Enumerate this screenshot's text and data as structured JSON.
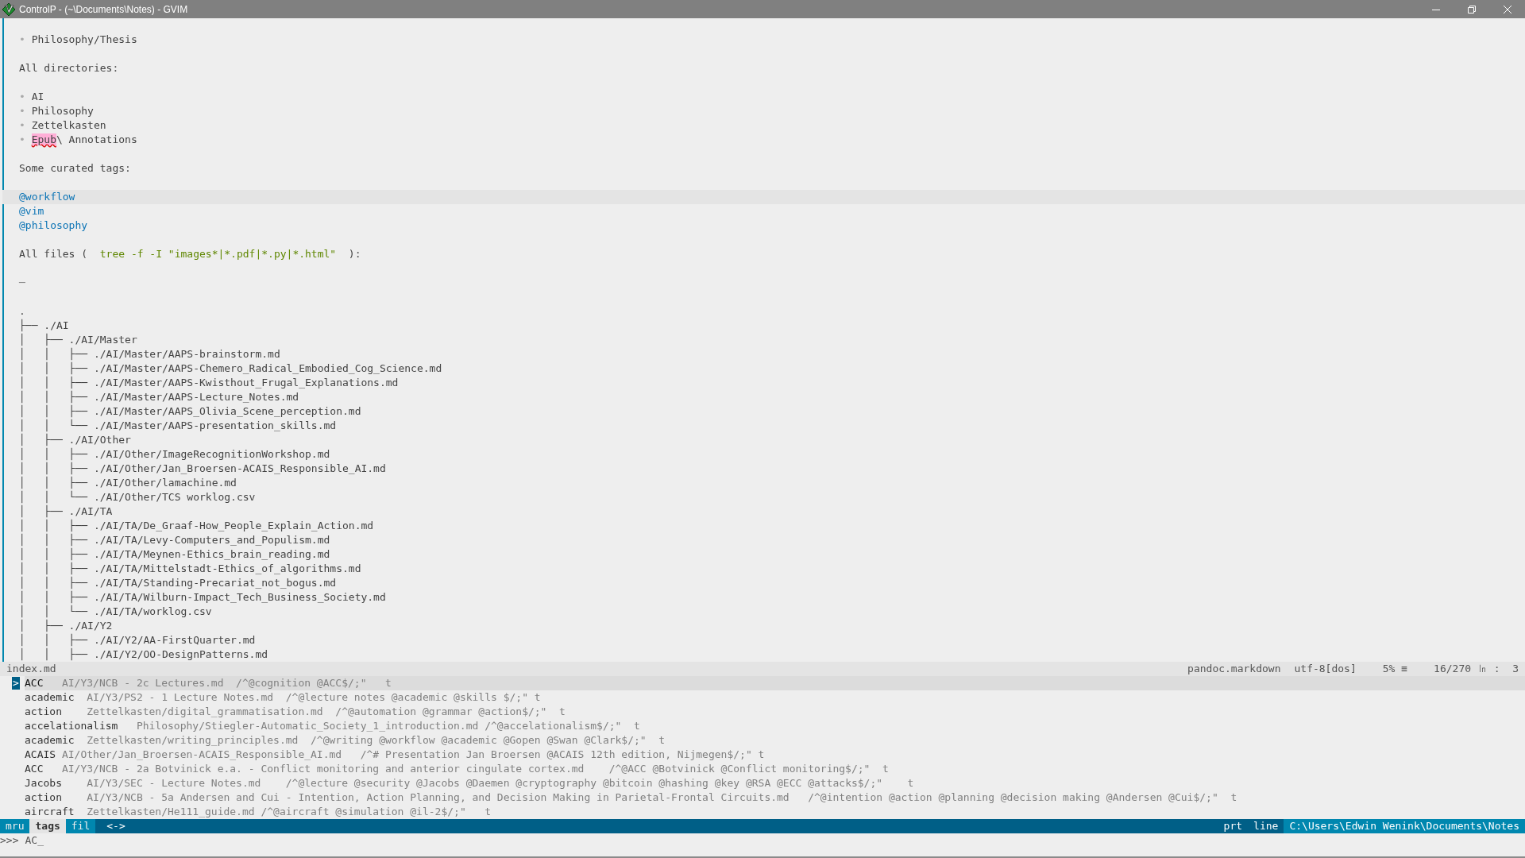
{
  "window": {
    "title": "ControlP - (~\\Documents\\Notes) - GVIM"
  },
  "editor": {
    "lines": [
      {
        "kind": "blank",
        "current": false
      },
      {
        "kind": "text",
        "current": false,
        "segments": [
          {
            "kind": "bullet",
            "text": "• "
          },
          {
            "kind": "plain",
            "text": "Philosophy/Thesis"
          }
        ]
      },
      {
        "kind": "blank",
        "current": false
      },
      {
        "kind": "text",
        "current": false,
        "segments": [
          {
            "kind": "plain",
            "text": "All directories:"
          }
        ]
      },
      {
        "kind": "blank",
        "current": false
      },
      {
        "kind": "text",
        "current": false,
        "segments": [
          {
            "kind": "bullet",
            "text": "• "
          },
          {
            "kind": "plain",
            "text": "AI"
          }
        ]
      },
      {
        "kind": "text",
        "current": false,
        "segments": [
          {
            "kind": "bullet",
            "text": "• "
          },
          {
            "kind": "plain",
            "text": "Philosophy"
          }
        ]
      },
      {
        "kind": "text",
        "current": false,
        "segments": [
          {
            "kind": "bullet",
            "text": "• "
          },
          {
            "kind": "plain",
            "text": "Zettelkasten"
          }
        ]
      },
      {
        "kind": "text",
        "current": false,
        "segments": [
          {
            "kind": "bullet",
            "text": "• "
          },
          {
            "kind": "spell",
            "text": "Epub"
          },
          {
            "kind": "plain",
            "text": "\\ Annotations"
          }
        ]
      },
      {
        "kind": "blank",
        "current": false
      },
      {
        "kind": "text",
        "current": false,
        "segments": [
          {
            "kind": "plain",
            "text": "Some curated tags:"
          }
        ]
      },
      {
        "kind": "blank",
        "current": false
      },
      {
        "kind": "text",
        "current": true,
        "segments": [
          {
            "kind": "tag",
            "text": "@workflow"
          }
        ]
      },
      {
        "kind": "text",
        "current": false,
        "segments": [
          {
            "kind": "tag",
            "text": "@vim"
          }
        ]
      },
      {
        "kind": "text",
        "current": false,
        "segments": [
          {
            "kind": "tag",
            "text": "@philosophy"
          }
        ]
      },
      {
        "kind": "blank",
        "current": false
      },
      {
        "kind": "text",
        "current": false,
        "segments": [
          {
            "kind": "plain",
            "text": "All files (  "
          },
          {
            "kind": "code",
            "text": "tree -f -I \"images*|*.pdf|*.py|*.html\""
          },
          {
            "kind": "plain",
            "text": "  ):"
          }
        ]
      },
      {
        "kind": "blank",
        "current": false
      },
      {
        "kind": "text",
        "current": false,
        "segments": [
          {
            "kind": "dim",
            "text": "─"
          }
        ]
      },
      {
        "kind": "blank",
        "current": false
      },
      {
        "kind": "text",
        "current": false,
        "segments": [
          {
            "kind": "plain",
            "text": "."
          }
        ]
      },
      {
        "kind": "text",
        "current": false,
        "segments": [
          {
            "kind": "plain",
            "text": "├── ./AI"
          }
        ]
      },
      {
        "kind": "text",
        "current": false,
        "segments": [
          {
            "kind": "plain",
            "text": "│   ├── ./AI/Master"
          }
        ]
      },
      {
        "kind": "text",
        "current": false,
        "segments": [
          {
            "kind": "plain",
            "text": "│   │   ├── ./AI/Master/AAPS-brainstorm.md"
          }
        ]
      },
      {
        "kind": "text",
        "current": false,
        "segments": [
          {
            "kind": "plain",
            "text": "│   │   ├── ./AI/Master/AAPS-Chemero_Radical_Embodied_Cog_Science.md"
          }
        ]
      },
      {
        "kind": "text",
        "current": false,
        "segments": [
          {
            "kind": "plain",
            "text": "│   │   ├── ./AI/Master/AAPS-Kwisthout_Frugal_Explanations.md"
          }
        ]
      },
      {
        "kind": "text",
        "current": false,
        "segments": [
          {
            "kind": "plain",
            "text": "│   │   ├── ./AI/Master/AAPS-Lecture_Notes.md"
          }
        ]
      },
      {
        "kind": "text",
        "current": false,
        "segments": [
          {
            "kind": "plain",
            "text": "│   │   ├── ./AI/Master/AAPS_Olivia_Scene_perception.md"
          }
        ]
      },
      {
        "kind": "text",
        "current": false,
        "segments": [
          {
            "kind": "plain",
            "text": "│   │   └── ./AI/Master/AAPS-presentation_skills.md"
          }
        ]
      },
      {
        "kind": "text",
        "current": false,
        "segments": [
          {
            "kind": "plain",
            "text": "│   ├── ./AI/Other"
          }
        ]
      },
      {
        "kind": "text",
        "current": false,
        "segments": [
          {
            "kind": "plain",
            "text": "│   │   ├── ./AI/Other/ImageRecognitionWorkshop.md"
          }
        ]
      },
      {
        "kind": "text",
        "current": false,
        "segments": [
          {
            "kind": "plain",
            "text": "│   │   ├── ./AI/Other/Jan_Broersen-ACAIS_Responsible_AI.md"
          }
        ]
      },
      {
        "kind": "text",
        "current": false,
        "segments": [
          {
            "kind": "plain",
            "text": "│   │   ├── ./AI/Other/lamachine.md"
          }
        ]
      },
      {
        "kind": "text",
        "current": false,
        "segments": [
          {
            "kind": "plain",
            "text": "│   │   └── ./AI/Other/TCS worklog.csv"
          }
        ]
      },
      {
        "kind": "text",
        "current": false,
        "segments": [
          {
            "kind": "plain",
            "text": "│   ├── ./AI/TA"
          }
        ]
      },
      {
        "kind": "text",
        "current": false,
        "segments": [
          {
            "kind": "plain",
            "text": "│   │   ├── ./AI/TA/De_Graaf-How_People_Explain_Action.md"
          }
        ]
      },
      {
        "kind": "text",
        "current": false,
        "segments": [
          {
            "kind": "plain",
            "text": "│   │   ├── ./AI/TA/Levy-Computers_and_Populism.md"
          }
        ]
      },
      {
        "kind": "text",
        "current": false,
        "segments": [
          {
            "kind": "plain",
            "text": "│   │   ├── ./AI/TA/Meynen-Ethics_brain_reading.md"
          }
        ]
      },
      {
        "kind": "text",
        "current": false,
        "segments": [
          {
            "kind": "plain",
            "text": "│   │   ├── ./AI/TA/Mittelstadt-Ethics_of_algorithms.md"
          }
        ]
      },
      {
        "kind": "text",
        "current": false,
        "segments": [
          {
            "kind": "plain",
            "text": "│   │   ├── ./AI/TA/Standing-Precariat_not_bogus.md"
          }
        ]
      },
      {
        "kind": "text",
        "current": false,
        "segments": [
          {
            "kind": "plain",
            "text": "│   │   ├── ./AI/TA/Wilburn-Impact_Tech_Business_Society.md"
          }
        ]
      },
      {
        "kind": "text",
        "current": false,
        "segments": [
          {
            "kind": "plain",
            "text": "│   │   └── ./AI/TA/worklog.csv"
          }
        ]
      },
      {
        "kind": "text",
        "current": false,
        "segments": [
          {
            "kind": "plain",
            "text": "│   ├── ./AI/Y2"
          }
        ]
      },
      {
        "kind": "text",
        "current": false,
        "segments": [
          {
            "kind": "plain",
            "text": "│   │   ├── ./AI/Y2/AA-FirstQuarter.md"
          }
        ]
      },
      {
        "kind": "text",
        "current": false,
        "segments": [
          {
            "kind": "plain",
            "text": "│   │   ├── ./AI/Y2/OO-DesignPatterns.md"
          }
        ]
      }
    ]
  },
  "status_line": {
    "file": "index.md",
    "filetype": "pandoc.markdown",
    "encoding": "utf-8[dos]",
    "percent": "5% ≡",
    "position": "16/270 ㏑ :  3"
  },
  "matches": {
    "marker": ">",
    "rows": [
      {
        "selected": true,
        "tag": "ACC",
        "rest": "   AI/Y3/NCB - 2c Lectures.md  /^@cognition @ACC$/;\"   t"
      },
      {
        "selected": false,
        "tag": "academic",
        "rest": "  AI/Y3/PS2 - 1 Lecture Notes.md  /^@lecture notes @academic @skills $/;\" t"
      },
      {
        "selected": false,
        "tag": "action",
        "rest": "    Zettelkasten/digital_grammatisation.md  /^@automation @grammar @action$/;\"  t"
      },
      {
        "selected": false,
        "tag": "accelationalism",
        "rest": "   Philosophy/Stiegler-Automatic_Society_1_introduction.md /^@accelationalism$/;\"  t"
      },
      {
        "selected": false,
        "tag": "academic",
        "rest": "  Zettelkasten/writing_principles.md  /^@writing @workflow @academic @Gopen @Swan @Clark$/;\"  t"
      },
      {
        "selected": false,
        "tag": "ACAIS",
        "rest": " AI/Other/Jan_Broersen-ACAIS_Responsible_AI.md   /^# Presentation Jan Broersen @ACAIS 12th edition, Nijmegen$/;\" t"
      },
      {
        "selected": false,
        "tag": "ACC",
        "rest": "   AI/Y3/NCB - 2a Botvinick e.a. - Conflict monitoring and anterior cingulate cortex.md    /^@ACC @Botvinick @Conflict monitoring$/;\"  t"
      },
      {
        "selected": false,
        "tag": "Jacobs",
        "rest": "    AI/Y3/SEC - Lecture Notes.md    /^@lecture @security @Jacobs @Daemen @cryptography @bitcoin @hashing @key @RSA @ECC @attacks$/;\"    t"
      },
      {
        "selected": false,
        "tag": "action",
        "rest": "    AI/Y3/NCB - 5a Andersen and Cui - Intention, Action Planning, and Decision Making in Parietal-Frontal Circuits.md   /^@intention @action @planning @decision making @Andersen @Cui$/;\"  t"
      },
      {
        "selected": false,
        "tag": "aircraft",
        "rest": "  Zettelkasten/He111_guide.md /^@aircraft @simulation @il-2$/;\"   t"
      }
    ]
  },
  "ctrlp_bar": {
    "modes": [
      {
        "label": "mru",
        "selected": false
      },
      {
        "label": "tags",
        "selected": true
      },
      {
        "label": "fil",
        "selected": false
      }
    ],
    "arrows": "<->",
    "prt": "prt",
    "scope": "line",
    "path": "C:\\Users\\Edwin Wenink\\Documents\\Notes"
  },
  "prompt": {
    "symbol": ">>>",
    "input": "AC_"
  }
}
